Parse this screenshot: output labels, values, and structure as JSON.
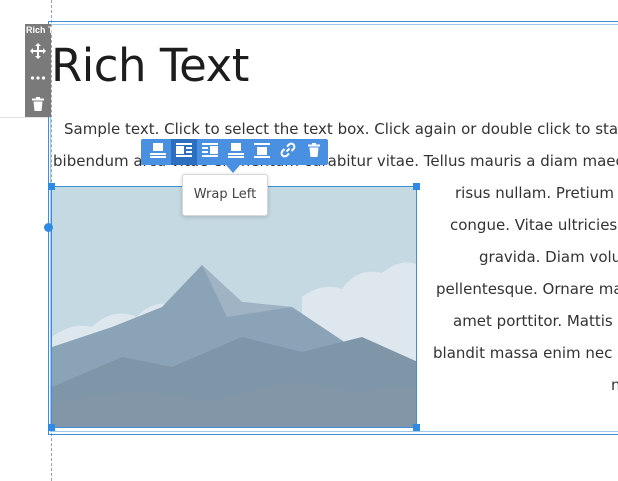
{
  "widget": {
    "label": "Rich Text",
    "heading": "Rich Text"
  },
  "body_lines": [
    "Sample text. Click to select the text box. Click again or double click to start e",
    "bibendum arcu vitae elementum curabitur vitae. Tellus mauris a diam maece",
    "risus nullam. Pretium f",
    "congue. Vitae ultricies l",
    "gravida. Diam volu",
    "pellentesque. Ornare ma",
    "amet porttitor. Mattis",
    "blandit massa enim nec d",
    "n"
  ],
  "toolbar": {
    "buttons": [
      {
        "name": "wrap-none-button",
        "icon": "align-top-icon"
      },
      {
        "name": "wrap-left-button",
        "icon": "wrap-left-icon",
        "active": true
      },
      {
        "name": "wrap-right-button",
        "icon": "wrap-right-icon"
      },
      {
        "name": "align-top-button",
        "icon": "align-top-icon"
      },
      {
        "name": "align-bottom-button",
        "icon": "align-bottom-icon"
      },
      {
        "name": "link-button",
        "icon": "link-icon"
      },
      {
        "name": "delete-button",
        "icon": "trash-icon"
      }
    ],
    "tooltip": "Wrap Left"
  },
  "colors": {
    "accent": "#4a90e2",
    "sky": "#c5d9e3",
    "mountain": "#8ba3b6"
  }
}
